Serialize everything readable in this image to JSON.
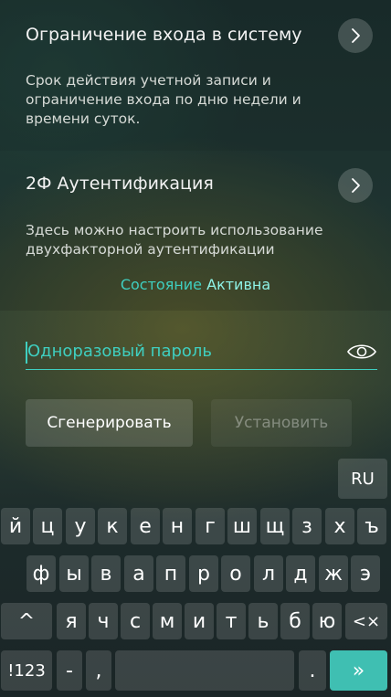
{
  "section_login": {
    "title": "Ограничение входа в систему",
    "description": "Срок действия учетной записи и ограничение входа по дню недели и времени суток."
  },
  "section_2fa": {
    "title": "2Ф Аутентификация",
    "description": "Здесь можно настроить использование двухфакторной аутентификации",
    "status_label": "Состояние",
    "status_value": "Активна"
  },
  "otp": {
    "placeholder": "Одноразовый пароль",
    "value": ""
  },
  "buttons": {
    "generate": "Сгенерировать",
    "set": "Установить"
  },
  "keyboard": {
    "lang": "RU",
    "row1": [
      "й",
      "ц",
      "у",
      "к",
      "е",
      "н",
      "г",
      "ш",
      "щ",
      "з",
      "х",
      "ъ"
    ],
    "row2": [
      "ф",
      "ы",
      "в",
      "а",
      "п",
      "р",
      "о",
      "л",
      "д",
      "ж",
      "э"
    ],
    "row3": [
      "я",
      "ч",
      "с",
      "м",
      "и",
      "т",
      "ь",
      "б",
      "ю"
    ],
    "shift": "^",
    "backspace": "<×",
    "mode": "!123",
    "dash": "-",
    "comma": ",",
    "dot": ".",
    "enter": "»"
  },
  "colors": {
    "accent": "#3fcfc0",
    "accent_light": "#8ef2e6",
    "enter_key": "#3fbfb2"
  },
  "icons": {
    "chevron": "chevron-right-icon",
    "eye": "eye-icon"
  }
}
